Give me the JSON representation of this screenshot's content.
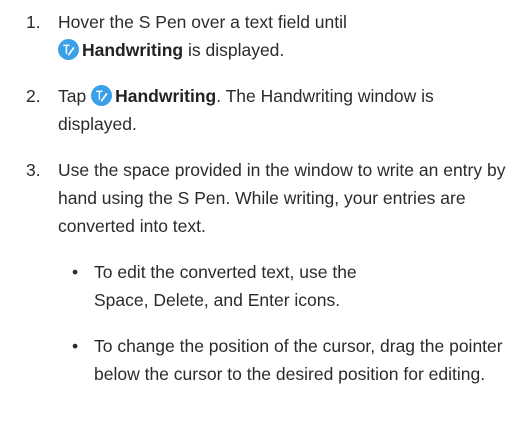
{
  "steps": [
    {
      "number": "1.",
      "line1": "Hover the S Pen over a text field until",
      "keyword": "Handwriting",
      "after": " is displayed."
    },
    {
      "number": "2.",
      "before": "Tap ",
      "keyword": "Handwriting",
      "after": ". The Handwriting window is displayed."
    },
    {
      "number": "3.",
      "text": "Use the space provided in the window to write an entry by hand using the S Pen. While writing, your entries are converted into text."
    }
  ],
  "bullets": [
    {
      "symbol": "•",
      "text": "To edit the converted text, use the Space, Delete, and Enter icons."
    },
    {
      "symbol": "•",
      "text": "To change the position of the cursor, drag the pointer below the cursor to the desired position for editing."
    }
  ],
  "colors": {
    "icon_blue": "#3aa0e8"
  },
  "icons": {
    "handwriting": "handwriting-icon"
  }
}
